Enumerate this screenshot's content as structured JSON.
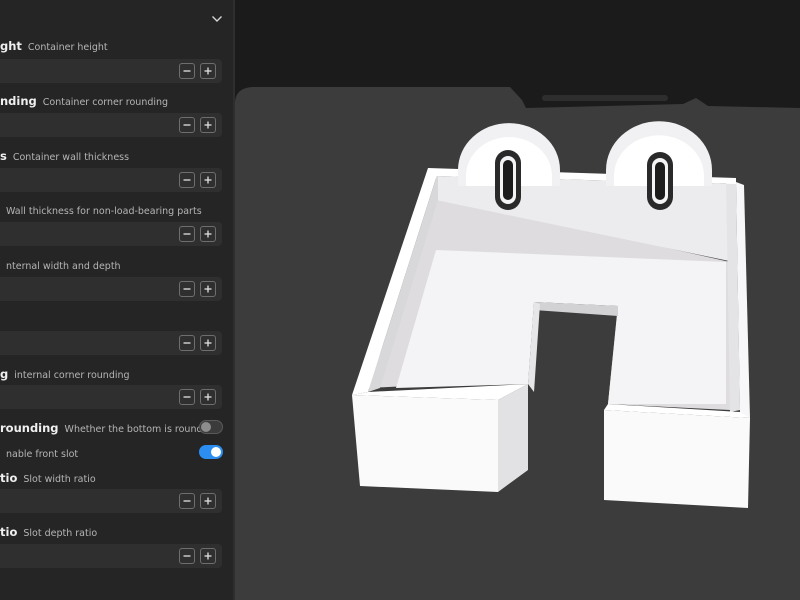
{
  "panel": {
    "params": [
      {
        "name": "ght",
        "desc": "Container height",
        "control": "number"
      },
      {
        "name": "nding",
        "desc": "Container corner rounding",
        "control": "number"
      },
      {
        "name": "s",
        "desc": "Container wall thickness",
        "control": "number"
      },
      {
        "name": "",
        "desc": "Wall thickness for non-load-bearing parts",
        "control": "number"
      },
      {
        "name": "",
        "desc": "nternal width and depth",
        "control": "number"
      },
      {
        "name": "",
        "desc": "",
        "control": "number"
      },
      {
        "name": "g",
        "desc": "internal corner rounding",
        "control": "number"
      },
      {
        "name": "rounding",
        "desc": "Whether the bottom is rounded",
        "control": "toggle",
        "state": "off"
      },
      {
        "name": "",
        "desc": "nable front slot",
        "control": "toggle",
        "state": "on"
      },
      {
        "name": "tio",
        "desc": "Slot width ratio",
        "control": "number"
      },
      {
        "name": "tio",
        "desc": "Slot depth ratio",
        "control": "number"
      }
    ]
  },
  "icons": {
    "collapse": "chevron-down-icon",
    "decrement": "minus-icon",
    "increment": "plus-icon"
  },
  "colors": {
    "panel_bg": "#252526",
    "viewport_bg": "#1b1b1b",
    "build_plate": "#3c3c3c",
    "toggle_on": "#2b8ef0",
    "model": "#f2f1f3"
  }
}
